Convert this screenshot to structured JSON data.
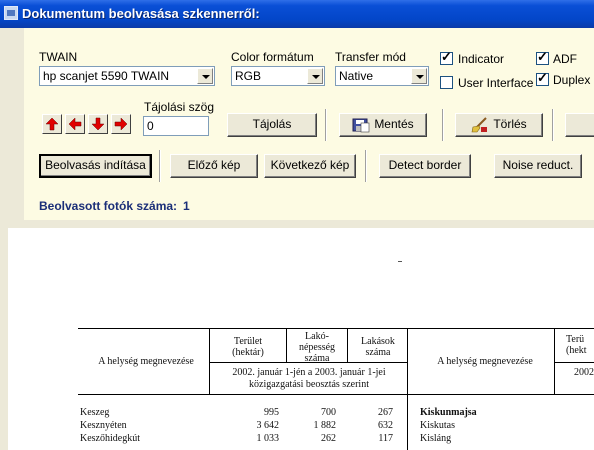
{
  "window": {
    "title": "Dokumentum beolvasása szkennerről:"
  },
  "source": {
    "label": "TWAIN",
    "value": "hp scanjet 5590 TWAIN"
  },
  "color": {
    "label": "Color formátum",
    "value": "RGB"
  },
  "transfer": {
    "label": "Transfer mód",
    "value": "Native"
  },
  "options": {
    "indicator": {
      "label": "Indicator",
      "checked": true
    },
    "user_interface": {
      "label": "User Interface",
      "checked": false
    },
    "adf": {
      "label": "ADF",
      "checked": true
    },
    "duplex": {
      "label": "Duplex",
      "checked": true
    }
  },
  "orientation": {
    "label": "Tájolási szög",
    "value": "0",
    "button": "Tájolás"
  },
  "toolbar": {
    "save": "Mentés",
    "delete": "Törlés"
  },
  "actions": {
    "start": "Beolvasás indítása",
    "prev": "Előző kép",
    "next": "Következő kép",
    "detect": "Detect border",
    "noise": "Noise reduct."
  },
  "status": {
    "label": "Beolvasott fotók száma:",
    "count": "1"
  },
  "preview": {
    "left": {
      "name_header": "A helység megnevezése",
      "col1": "Terület (hektár)",
      "col2": "Lakó-népesség száma",
      "col3": "Lakások száma",
      "subheader_1": "2002. január 1-jén a 2003. január 1-jei",
      "subheader_2": "közigazgatási beosztás szerint",
      "rows": [
        {
          "name": "Keszeg",
          "area": "995",
          "pop": "700",
          "homes": "267"
        },
        {
          "name": "Kesznyéten",
          "area": "3 642",
          "pop": "1 882",
          "homes": "632"
        },
        {
          "name": "Keszőhidegkút",
          "area": "1 033",
          "pop": "262",
          "homes": "117"
        }
      ]
    },
    "right": {
      "name_header": "A helység megnevezése",
      "col1": "Terü (hekt",
      "subheader": "2002",
      "rows": [
        "Kiskunmajsa",
        "Kiskutas",
        "Kisláng"
      ]
    }
  }
}
